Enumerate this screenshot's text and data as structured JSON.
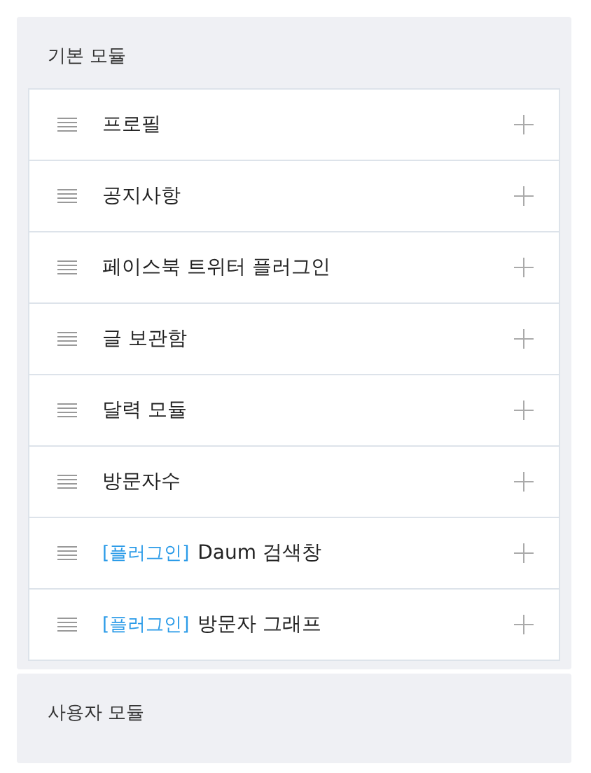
{
  "sections": [
    {
      "title": "기본 모듈",
      "items": [
        {
          "name": "프로필"
        },
        {
          "name": "공지사항"
        },
        {
          "name": "페이스북 트위터 플러그인"
        },
        {
          "name": "글 보관함"
        },
        {
          "name": "달력 모듈"
        },
        {
          "name": "방문자수"
        },
        {
          "tag": "[플러그인]",
          "name": "Daum 검색창"
        },
        {
          "tag": "[플러그인]",
          "name": "방문자 그래프"
        }
      ]
    },
    {
      "title": "사용자 모듈"
    }
  ]
}
